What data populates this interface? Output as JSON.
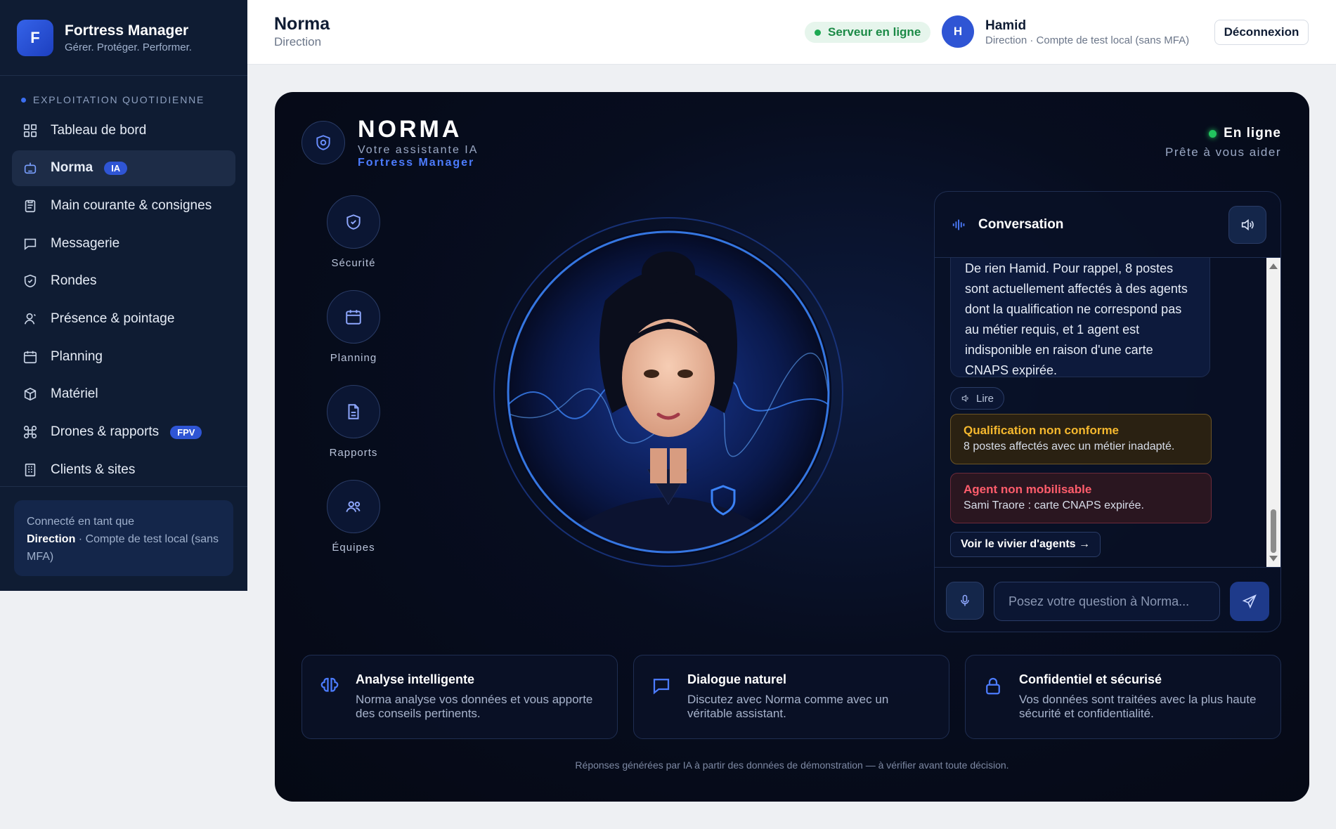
{
  "brand": {
    "logo_letter": "F",
    "name": "Fortress Manager",
    "tagline": "Gérer. Protéger. Performer."
  },
  "sidebar": {
    "section_title": "EXPLOITATION QUOTIDIENNE",
    "items": [
      {
        "label": "Tableau de bord",
        "icon": "dashboard-icon"
      },
      {
        "label": "Norma",
        "icon": "robot-icon",
        "badge": "IA",
        "active": true
      },
      {
        "label": "Main courante & consignes",
        "icon": "clipboard-icon"
      },
      {
        "label": "Messagerie",
        "icon": "message-icon"
      },
      {
        "label": "Rondes",
        "icon": "shield-icon"
      },
      {
        "label": "Présence & pointage",
        "icon": "user-icon"
      },
      {
        "label": "Planning",
        "icon": "calendar-icon"
      },
      {
        "label": "Matériel",
        "icon": "box-icon"
      },
      {
        "label": "Drones & rapports",
        "icon": "drone-icon",
        "badge": "FPV"
      },
      {
        "label": "Clients & sites",
        "icon": "building-icon"
      }
    ],
    "account": {
      "prefix": "Connecté en tant que",
      "role": "Direction",
      "suffix": " · Compte de test local (sans MFA)"
    }
  },
  "header": {
    "title": "Norma",
    "subtitle": "Direction",
    "server_status": "Serveur en ligne",
    "user_initial": "H",
    "user_name": "Hamid",
    "user_role": "Direction · Compte de test local (sans MFA)",
    "logout_label": "Déconnexion"
  },
  "norma": {
    "title": "NORMA",
    "subtitle": "Votre assistante IA",
    "subtitle2": "Fortress Manager",
    "status": "En ligne",
    "status_sub": "Prête à vous aider",
    "actions": [
      {
        "label": "Sécurité",
        "icon": "shield-check-icon"
      },
      {
        "label": "Planning",
        "icon": "calendar-icon"
      },
      {
        "label": "Rapports",
        "icon": "document-icon"
      },
      {
        "label": "Équipes",
        "icon": "team-icon"
      }
    ]
  },
  "conversation": {
    "title": "Conversation",
    "message": "De rien Hamid. Pour rappel, 8 postes sont actuellement affectés à des agents dont la qualification ne correspond pas au métier requis, et 1 agent est indisponible en raison d'une carte CNAPS expirée.",
    "read_label": "Lire",
    "alert_warn": {
      "title": "Qualification non conforme",
      "text": "8 postes affectés avec un métier inadapté."
    },
    "alert_danger": {
      "title": "Agent non mobilisable",
      "text": "Sami Traore : carte CNAPS expirée."
    },
    "vivier_label": "Voir le vivier d'agents →",
    "input_placeholder": "Posez votre question à Norma...",
    "input_value": ""
  },
  "features": [
    {
      "title": "Analyse intelligente",
      "text": "Norma analyse vos données et vous apporte des conseils pertinents.",
      "icon": "brain-icon"
    },
    {
      "title": "Dialogue naturel",
      "text": "Discutez avec Norma comme avec un véritable assistant.",
      "icon": "chat-icon"
    },
    {
      "title": "Confidentiel et sécurisé",
      "text": "Vos données sont traitées avec la plus haute sécurité et confidentialité.",
      "icon": "lock-icon"
    }
  ],
  "disclaimer": "Réponses générées par IA à partir des données de démonstration — à vérifier avant toute décision.",
  "colors": {
    "accent": "#3563e9",
    "sidebar_bg": "#0f1c33",
    "panel_bg": "#070d1f",
    "success": "#22c55e",
    "warning": "#f5b82e",
    "danger": "#ff5d6c"
  }
}
